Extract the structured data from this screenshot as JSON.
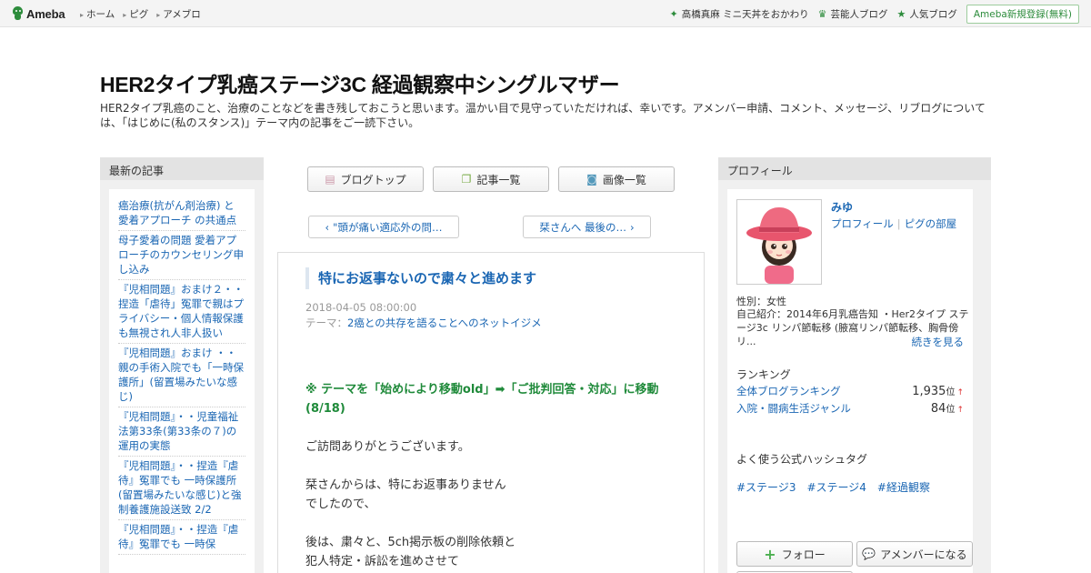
{
  "topbar": {
    "logo_text": "Ameba",
    "nav": [
      "ホーム",
      "ピグ",
      "アメブロ"
    ],
    "right_links": [
      {
        "label": "高橋真麻 ミニ天丼をおかわり",
        "icon": "sparkle-icon"
      },
      {
        "label": "芸能人ブログ",
        "icon": "crown-icon"
      },
      {
        "label": "人気ブログ",
        "icon": "star-icon"
      }
    ],
    "signup": "Ameba新規登録(無料)"
  },
  "header": {
    "title": "HER2タイプ乳癌ステージ3C 経過観察中シングルマザー",
    "description": "HER2タイプ乳癌のこと、治療のことなどを書き残しておこうと思います。温かい目で見守っていただければ、幸いです。アメンバー申請、コメント、メッセージ、リブログについては、「はじめに(私のスタンス)」テーマ内の記事をご一読下さい。"
  },
  "left": {
    "heading": "最新の記事",
    "items": [
      "癌治療(抗がん剤治療) と 愛着アプローチ の共通点",
      "母子愛着の問題 愛着アプローチのカウンセリング申し込み",
      "『児相問題』おまけ２・・捏造「虐待」冤罪で親はプライバシー・個人情報保護も無視され人非人扱い",
      "『児相問題』おまけ ・・親の手術入院でも「一時保護所」(留置場みたいな感じ)",
      "『児相問題』・・児童福祉法第33条(第33条の７)の運用の実態",
      "『児相問題』・・捏造『虐待』冤罪でも 一時保護所(留置場みたいな感じ)と強制養護施設送致 2/2",
      "『児相問題』・・捏造『虐待』冤罪でも 一時保"
    ]
  },
  "center": {
    "buttons": [
      {
        "label": "ブログトップ",
        "icon": "document-icon"
      },
      {
        "label": "記事一覧",
        "icon": "list-icon"
      },
      {
        "label": "画像一覧",
        "icon": "camera-icon"
      }
    ],
    "prev_label": "\"頭が痛い適応外の問…",
    "next_label": "栞さんへ 最後の…",
    "article": {
      "title": "特にお返事ないので粛々と進めます",
      "date": "2018-04-05 08:00:00",
      "theme_prefix": "テーマ：",
      "theme": "2癌との共存を語ることへのネットイジメ",
      "note": "※ テーマを「始めにより移動old」➡「ご批判回答・対応」に移動(8/18)",
      "p1": "ご訪問ありがとうございます。",
      "p2a": "栞さんからは、特にお返事ありません",
      "p2b": "でしたので、",
      "p3a": "後は、粛々と、5ch掲示板の削除依頼と",
      "p3b": "犯人特定・訴訟を進めさせて"
    }
  },
  "right": {
    "heading": "プロフィール",
    "name": "みゆ",
    "link_profile": "プロフィール",
    "link_pigg": "ピグの部屋",
    "gender": "性別：女性",
    "intro": "自己紹介：2014年6月乳癌告知 ・Her2タイプ ステージ3c リンパ節転移 (腋窩リンパ節転移、胸骨傍リ...",
    "more": "続きを見る",
    "ranking_heading": "ランキング",
    "rankings": [
      {
        "label": "全体ブログランキング",
        "value": "1,935",
        "unit": "位",
        "trend": "↑"
      },
      {
        "label": "入院・闘病生活ジャンル",
        "value": "84",
        "unit": "位",
        "trend": "↑"
      }
    ],
    "hashtag_heading": "よく使う公式ハッシュタグ",
    "hashtags": [
      "#ステージ3",
      "#ステージ4",
      "#経過観察"
    ],
    "follow": "フォロー",
    "member": "アメンバーになる"
  },
  "colors": {
    "link": "#1a66b3",
    "accent_green": "#2d8c3c",
    "note_green": "#1f8a3a"
  }
}
